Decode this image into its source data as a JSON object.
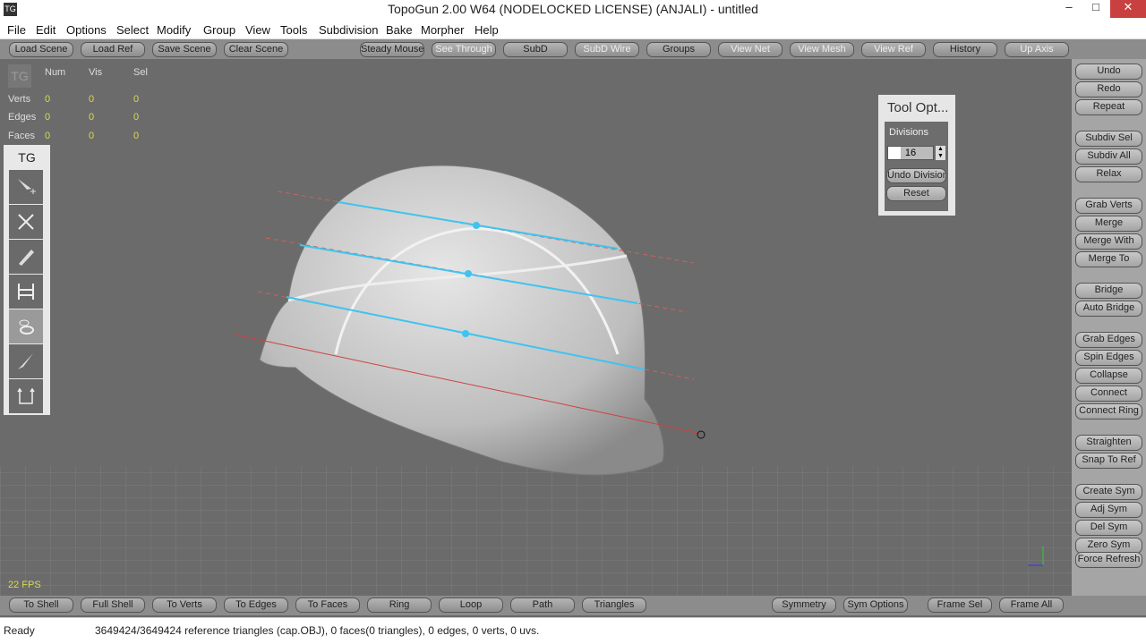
{
  "window": {
    "title": "TopoGun 2.00 W64  (NODELOCKED LICENSE) (ANJALI) - untitled",
    "logo": "TG"
  },
  "menu": [
    "File",
    "Edit",
    "Options",
    "Select",
    "Modify",
    "Group",
    "View",
    "Tools",
    "Subdivision",
    "Bake",
    "Morpher",
    "Help"
  ],
  "top_toolbar": [
    "Load Scene",
    "Load Ref",
    "Save Scene",
    "Clear Scene",
    "Steady Mouse",
    "See Through",
    "SubD",
    "SubD Wire",
    "Groups",
    "View Net",
    "View Mesh",
    "View Ref",
    "History",
    "Up Axis"
  ],
  "stats": {
    "headers": [
      "Num",
      "Vis",
      "Sel"
    ],
    "rows": [
      {
        "label": "Verts",
        "values": [
          "0",
          "0",
          "0"
        ]
      },
      {
        "label": "Edges",
        "values": [
          "0",
          "0",
          "0"
        ]
      },
      {
        "label": "Faces",
        "values": [
          "0",
          "0",
          "0"
        ]
      }
    ]
  },
  "toolstrip": {
    "title": "TG",
    "tools": [
      "create-tool-icon",
      "delete-tool-icon",
      "draw-tool-icon",
      "bridge-tool-icon",
      "rings-tool-icon",
      "brush-tool-icon",
      "extrude-tool-icon"
    ],
    "selected": "rings-tool-icon"
  },
  "tool_options": {
    "title": "Tool Opt...",
    "divisions_label": "Divisions",
    "divisions_value": "16",
    "undo_division": "Undo Division",
    "reset": "Reset"
  },
  "fps": "22 FPS",
  "right_panel": [
    "Undo",
    "Redo",
    "Repeat",
    "Subdiv Sel",
    "Subdiv All",
    "Relax",
    "Grab Verts",
    "Merge",
    "Merge With",
    "Merge To",
    "Bridge",
    "Auto Bridge",
    "Grab Edges",
    "Spin Edges",
    "Collapse",
    "Connect",
    "Connect Ring",
    "Straighten",
    "Snap To Ref",
    "Create Sym",
    "Adj Sym",
    "Del Sym",
    "Zero Sym",
    "Force Refresh"
  ],
  "bottom_toolbar": [
    "To Shell",
    "Full Shell",
    "To Verts",
    "To Edges",
    "To Faces",
    "Ring",
    "Loop",
    "Path",
    "Triangles"
  ],
  "bottom_right": [
    "Symmetry",
    "Sym Options",
    "Frame Sel",
    "Frame All"
  ],
  "status": {
    "state": "Ready",
    "message": "3649424/3649424 reference triangles (cap.OBJ), 0 faces(0 triangles), 0 edges, 0 verts, 0 uvs."
  },
  "colors": {
    "stroke_line": "#3fc3f0",
    "guide_red": "#d04040"
  }
}
